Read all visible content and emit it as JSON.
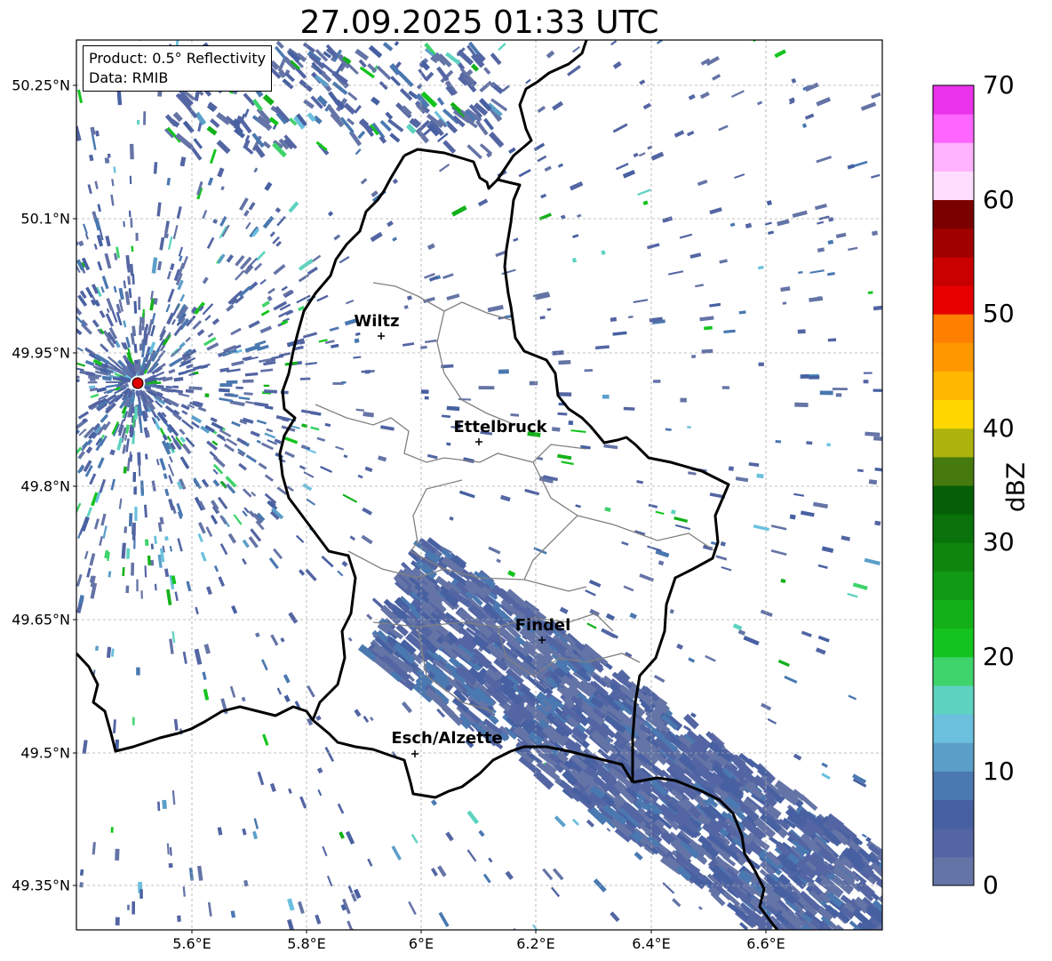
{
  "title": "27.09.2025 01:33 UTC",
  "info_box": {
    "product": "Product: 0.5° Reflectivity",
    "source": "Data: RMIB"
  },
  "lat_labels": [
    "50.25°N",
    "50.1°N",
    "49.95°N",
    "49.8°N",
    "49.65°N",
    "49.5°N",
    "49.35°N"
  ],
  "lon_labels": [
    "5.6°E",
    "5.8°E",
    "6°E",
    "6.2°E",
    "6.4°E",
    "6.6°E"
  ],
  "cities": [
    "Wiltz",
    "Ettelbruck",
    "Findel",
    "Esch/Alzette"
  ],
  "colorbar": {
    "label": "dBZ",
    "ticks": [
      "0",
      "10",
      "20",
      "30",
      "40",
      "50",
      "60",
      "70"
    ],
    "colors": [
      "#6574a6",
      "#5365a3",
      "#4760a1",
      "#4a78b0",
      "#5b9fc9",
      "#6ac0dd",
      "#5ed3c0",
      "#3fd36b",
      "#14c41e",
      "#13b01a",
      "#119a14",
      "#0e860e",
      "#0a720a",
      "#065f06",
      "#467a0e",
      "#acb30c",
      "#ffd700",
      "#ffb700",
      "#ff9800",
      "#ff7f00",
      "#e60000",
      "#c80000",
      "#a00000",
      "#7a0000",
      "#ffddff",
      "#ffb2ff",
      "#ff66ff",
      "#e932e9"
    ]
  },
  "radar_marker_color": "#e00000"
}
